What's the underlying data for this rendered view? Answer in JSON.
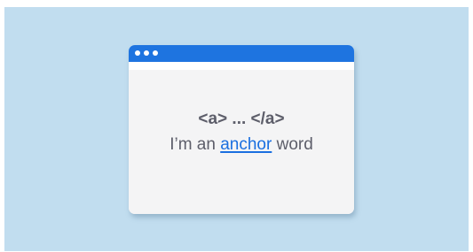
{
  "colors": {
    "background": "#c1ddef",
    "titlebar": "#1e74e0",
    "window": "#f4f4f5",
    "text": "#5d5e6a",
    "link": "#1a6fe0"
  },
  "window": {
    "titlebar_icons": [
      "window-dot-icon",
      "window-dot-icon",
      "window-dot-icon"
    ],
    "code": "<a> ... </a>",
    "sentence": {
      "before": "I’m an ",
      "link": "anchor",
      "after": " word"
    }
  }
}
